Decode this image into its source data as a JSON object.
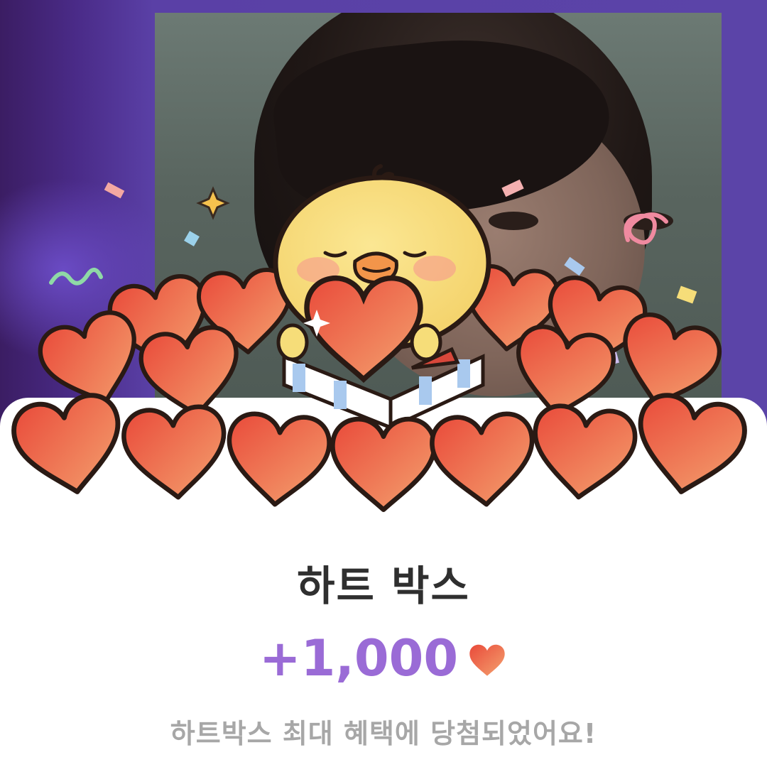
{
  "reward": {
    "title": "하트 박스",
    "amount": "+1,000",
    "message": "하트박스 최대 혜택에 당첨되었어요!"
  },
  "icons": {
    "currency": "heart-icon",
    "mascot": "chick-mascot"
  },
  "colors": {
    "amount": "#9a6bd6",
    "heart": "#ef6a4e",
    "background": "#5a40a6"
  }
}
